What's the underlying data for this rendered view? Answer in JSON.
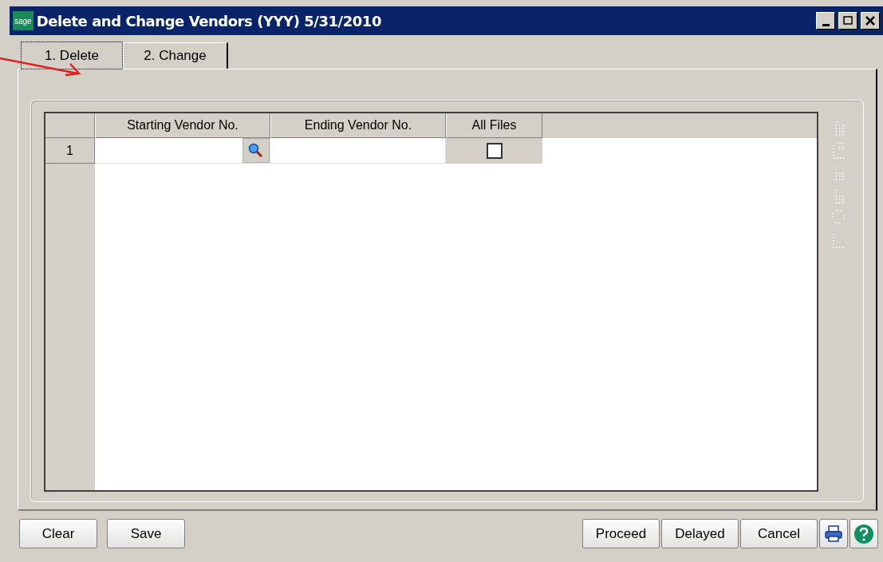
{
  "window": {
    "title": "Delete and Change Vendors (YYY) 5/31/2010",
    "logo": "sage"
  },
  "tabs": [
    {
      "label": "1. Delete",
      "selected": true
    },
    {
      "label": "2. Change",
      "selected": false
    }
  ],
  "grid": {
    "columns": [
      "Starting Vendor No.",
      "Ending Vendor No.",
      "All Files"
    ],
    "rows": [
      {
        "number": "1",
        "starting_vendor": "",
        "ending_vendor": "",
        "all_files_checked": false
      }
    ]
  },
  "buttons_left": [
    "Clear",
    "Save"
  ],
  "buttons_right": [
    "Proceed",
    "Delayed",
    "Cancel"
  ]
}
